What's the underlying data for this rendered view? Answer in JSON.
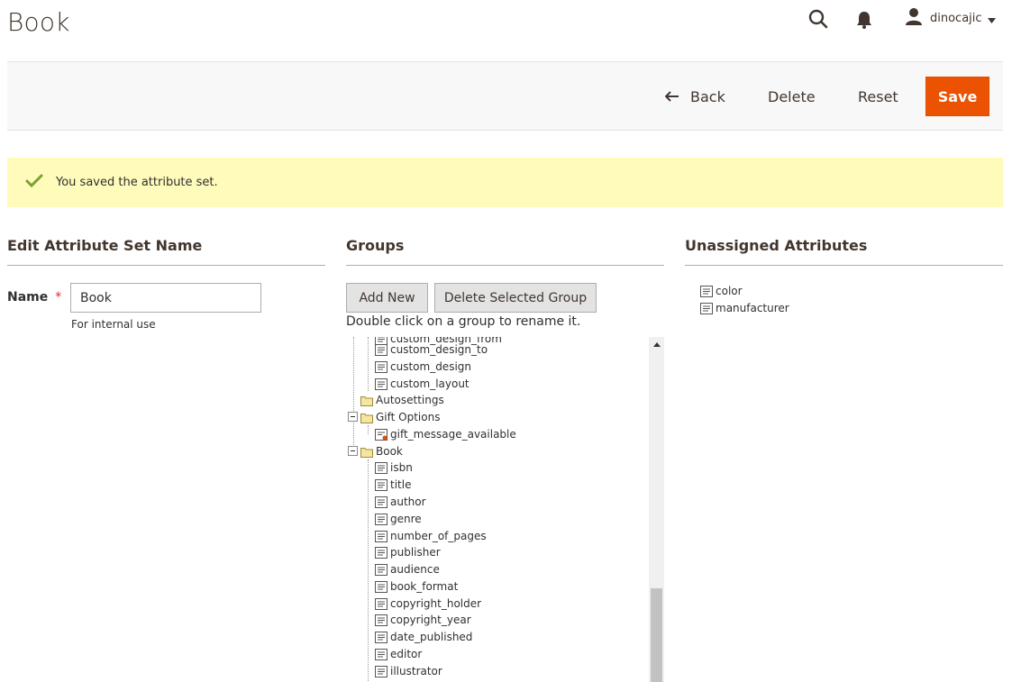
{
  "page": {
    "title": "Book"
  },
  "header": {
    "username": "dinocajic"
  },
  "actions": {
    "back": "Back",
    "delete": "Delete",
    "reset": "Reset",
    "save": "Save"
  },
  "message": {
    "text": "You saved the attribute set."
  },
  "left": {
    "title": "Edit Attribute Set Name",
    "name_label": "Name",
    "required_mark": "*",
    "name_value": "Book",
    "note": "For internal use"
  },
  "groups": {
    "title": "Groups",
    "add_new": "Add New",
    "delete_selected": "Delete Selected Group",
    "hint": "Double click on a group to rename it.",
    "tree": [
      {
        "label": "custom_design_from",
        "type": "attr",
        "level": 2
      },
      {
        "label": "custom_design_to",
        "type": "attr",
        "level": 2
      },
      {
        "label": "custom_design",
        "type": "attr",
        "level": 2
      },
      {
        "label": "custom_layout",
        "type": "attr",
        "level": 2
      },
      {
        "label": "Autosettings",
        "type": "folder",
        "level": 1
      },
      {
        "label": "Gift Options",
        "type": "folder",
        "level": 1,
        "expanded": true
      },
      {
        "label": "gift_message_available",
        "type": "attr-locked",
        "level": 2
      },
      {
        "label": "Book",
        "type": "folder",
        "level": 1,
        "expanded": true
      },
      {
        "label": "isbn",
        "type": "attr",
        "level": 2
      },
      {
        "label": "title",
        "type": "attr",
        "level": 2
      },
      {
        "label": "author",
        "type": "attr",
        "level": 2
      },
      {
        "label": "genre",
        "type": "attr",
        "level": 2
      },
      {
        "label": "number_of_pages",
        "type": "attr",
        "level": 2
      },
      {
        "label": "publisher",
        "type": "attr",
        "level": 2
      },
      {
        "label": "audience",
        "type": "attr",
        "level": 2
      },
      {
        "label": "book_format",
        "type": "attr",
        "level": 2
      },
      {
        "label": "copyright_holder",
        "type": "attr",
        "level": 2
      },
      {
        "label": "copyright_year",
        "type": "attr",
        "level": 2
      },
      {
        "label": "date_published",
        "type": "attr",
        "level": 2
      },
      {
        "label": "editor",
        "type": "attr",
        "level": 2
      },
      {
        "label": "illustrator",
        "type": "attr",
        "level": 2
      }
    ]
  },
  "unassigned": {
    "title": "Unassigned Attributes",
    "items": [
      "color",
      "manufacturer"
    ]
  },
  "colors": {
    "accent": "#eb5202",
    "message_bg": "#fffbbb"
  }
}
